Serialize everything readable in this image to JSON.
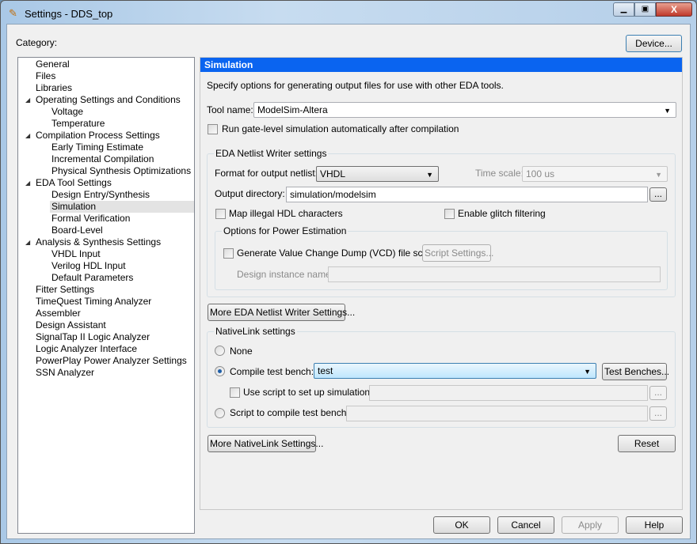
{
  "window": {
    "title": "Settings - DDS_top",
    "icon": "pencil-icon"
  },
  "category_label": "Category:",
  "device_button": "Device...",
  "tree": [
    {
      "label": "General",
      "level": 0
    },
    {
      "label": "Files",
      "level": 0
    },
    {
      "label": "Libraries",
      "level": 0
    },
    {
      "label": "Operating Settings and Conditions",
      "level": 0,
      "expanded": true
    },
    {
      "label": "Voltage",
      "level": 1
    },
    {
      "label": "Temperature",
      "level": 1
    },
    {
      "label": "Compilation Process Settings",
      "level": 0,
      "expanded": true
    },
    {
      "label": "Early Timing Estimate",
      "level": 1
    },
    {
      "label": "Incremental Compilation",
      "level": 1
    },
    {
      "label": "Physical Synthesis Optimizations",
      "level": 1
    },
    {
      "label": "EDA Tool Settings",
      "level": 0,
      "expanded": true
    },
    {
      "label": "Design Entry/Synthesis",
      "level": 1
    },
    {
      "label": "Simulation",
      "level": 1,
      "selected": true
    },
    {
      "label": "Formal Verification",
      "level": 1
    },
    {
      "label": "Board-Level",
      "level": 1
    },
    {
      "label": "Analysis & Synthesis Settings",
      "level": 0,
      "expanded": true
    },
    {
      "label": "VHDL Input",
      "level": 1
    },
    {
      "label": "Verilog HDL Input",
      "level": 1
    },
    {
      "label": "Default Parameters",
      "level": 1
    },
    {
      "label": "Fitter Settings",
      "level": 0
    },
    {
      "label": "TimeQuest Timing Analyzer",
      "level": 0
    },
    {
      "label": "Assembler",
      "level": 0
    },
    {
      "label": "Design Assistant",
      "level": 0
    },
    {
      "label": "SignalTap II Logic Analyzer",
      "level": 0
    },
    {
      "label": "Logic Analyzer Interface",
      "level": 0
    },
    {
      "label": "PowerPlay Power Analyzer Settings",
      "level": 0
    },
    {
      "label": "SSN Analyzer",
      "level": 0
    }
  ],
  "panel": {
    "header": "Simulation",
    "header_color": "#0a64f0",
    "description": "Specify options for generating output files for use with other EDA tools.",
    "tool_name_label": "Tool name:",
    "tool_name_value": "ModelSim-Altera",
    "gate_level_label": "Run gate-level simulation automatically after compilation",
    "eda_group": "EDA Netlist Writer settings",
    "format_label": "Format for output netlist:",
    "format_value": "VHDL",
    "time_scale_label": "Time scale:",
    "time_scale_value": "100 us",
    "output_dir_label": "Output directory:",
    "output_dir_value": "simulation/modelsim",
    "browse": "...",
    "map_illegal_label": "Map illegal HDL characters",
    "glitch_label": "Enable glitch filtering",
    "power_group": "Options for Power Estimation",
    "vcd_label": "Generate Value Change Dump (VCD) file script",
    "script_settings": "Script Settings...",
    "design_instance_label": "Design instance name:",
    "more_eda": "More EDA Netlist Writer Settings...",
    "nativelink_group": "NativeLink settings",
    "none_label": "None",
    "compile_tb_label": "Compile test bench:",
    "compile_tb_value": "test",
    "test_benches": "Test Benches...",
    "use_script_label": "Use script to set up simulation:",
    "script_compile_label": "Script to compile test bench:",
    "more_nativelink": "More NativeLink Settings...",
    "reset": "Reset"
  },
  "footer": {
    "ok": "OK",
    "cancel": "Cancel",
    "apply": "Apply",
    "help": "Help"
  }
}
